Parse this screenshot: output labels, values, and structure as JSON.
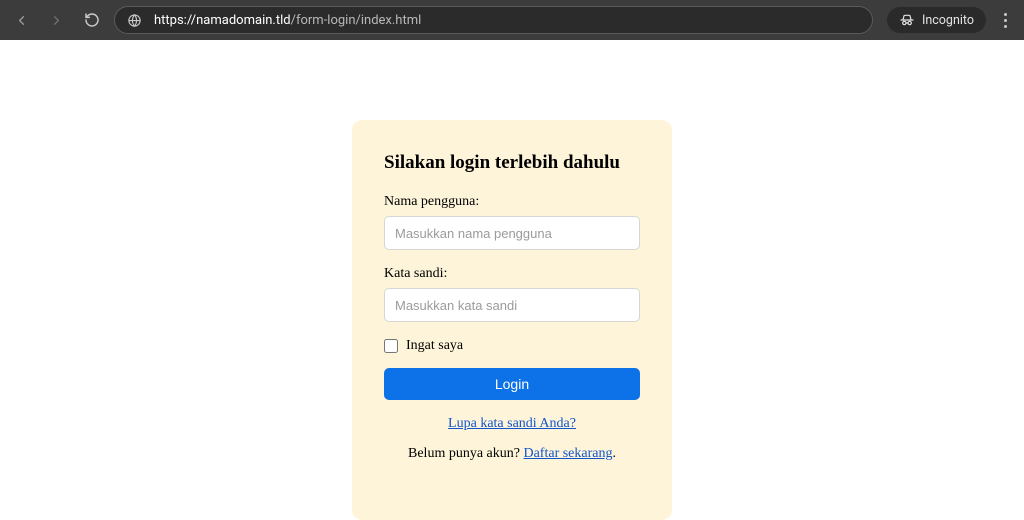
{
  "browser": {
    "url_host": "https://namadomain.tld",
    "url_path": "/form-login/index.html",
    "incognito_label": "Incognito"
  },
  "login": {
    "heading": "Silakan login terlebih dahulu",
    "username_label": "Nama pengguna:",
    "username_placeholder": "Masukkan nama pengguna",
    "password_label": "Kata sandi:",
    "password_placeholder": "Masukkan kata sandi",
    "remember_label": "Ingat saya",
    "submit_label": "Login",
    "forgot_link": "Lupa kata sandi Anda?",
    "signup_prefix": "Belum punya akun? ",
    "signup_link": "Daftar sekarang",
    "signup_suffix": "."
  }
}
